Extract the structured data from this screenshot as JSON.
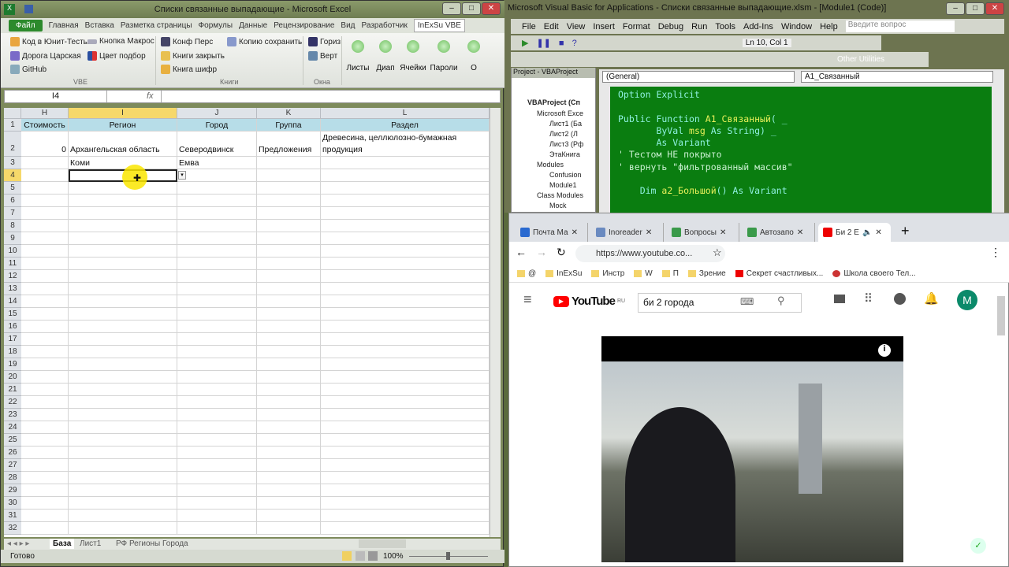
{
  "excel": {
    "title": "Списки связанные выпадающие - Microsoft Excel",
    "tabs": [
      "Файл",
      "Главная",
      "Вставка",
      "Разметка страницы",
      "Формулы",
      "Данные",
      "Рецензирование",
      "Вид",
      "Разработчик",
      "InExSu VBE"
    ],
    "ribbon": {
      "vbe": [
        "Код в Юнит-Тесты",
        "Кнопка Макрос",
        "Дорога Царская",
        "Цвет подбор",
        "GitHub"
      ],
      "vbe_group": "VBE",
      "books": [
        "Конф Перс",
        "Копию сохранить",
        "Книги закрыть",
        "Книга шифр"
      ],
      "books_group": "Книги",
      "windows": [
        "Гориз",
        "Верт"
      ],
      "windows_group": "Окна",
      "big": [
        "Листы",
        "Диап",
        "Ячейки",
        "Пароли",
        "О"
      ]
    },
    "name_box": "I4",
    "fx": "fx",
    "columns": [
      "H",
      "I",
      "J",
      "K",
      "L"
    ],
    "rows": [
      "1",
      "2",
      "3",
      "4",
      "5",
      "6",
      "7",
      "8",
      "9",
      "10",
      "11",
      "12",
      "13",
      "14",
      "15",
      "16",
      "17",
      "18",
      "19",
      "20",
      "21",
      "22",
      "23",
      "24",
      "25",
      "26",
      "27",
      "28",
      "29",
      "30",
      "31",
      "32"
    ],
    "cells": {
      "r1": [
        "Стоимость",
        "Регион",
        "Город",
        "Группа",
        "Раздел"
      ],
      "r2": [
        "0",
        "Архангельская область",
        "Северодвинск",
        "Предложения",
        "Древесина, целлюлозно-бумажная",
        "продукция"
      ],
      "r3": [
        "",
        "Коми",
        "Емва",
        "",
        ""
      ]
    },
    "sheets": [
      "База",
      "Лист1",
      "РФ Регионы Города"
    ],
    "status": "Готово",
    "zoom": "100%"
  },
  "vba": {
    "title": "Microsoft Visual Basic for Applications - Списки связанные выпадающие.xlsm - [Module1 (Code)]",
    "menu": [
      "File",
      "Edit",
      "View",
      "Insert",
      "Format",
      "Debug",
      "Run",
      "Tools",
      "Add-Ins",
      "Window",
      "Help"
    ],
    "help_placeholder": "Введите вопрос",
    "position": "Ln 10, Col 1",
    "other_utilities": "Other Utilities",
    "project_title": "Project - VBAProject",
    "tree": [
      "VBAProject (Сп",
      "Microsoft Exce",
      "Лист1 (Ба",
      "Лист2 (Л",
      "Лист3 (Рф",
      "ЭтаКнига",
      "Modules",
      "Confusion",
      "Module1",
      "Class Modules",
      "Mock"
    ],
    "general": "(General)",
    "proc": "A1_Связанный",
    "code": {
      "l1": "Option Explicit",
      "l2a": "Public Function ",
      "l2b": "A1_Связанный",
      "l2c": "( _",
      "l3a": "       ByVal ",
      "l3b": "msg",
      "l3c": " As String) _",
      "l4": "       As Variant",
      "l5": "' Тестом НЕ покрыто",
      "l6": "' вернуть \"фильтрованный массив\"",
      "l7a": "    Dim ",
      "l7b": "a2_Большой",
      "l7c": "() As Variant"
    }
  },
  "chrome": {
    "tabs": [
      "Почта Ма",
      "Inoreader",
      "Вопросы",
      "Автозапо",
      "Би 2 Е"
    ],
    "url": "https://www.youtube.co...",
    "bookmarks": [
      "@",
      "InExSu",
      "Инстр",
      "W",
      "П",
      "Зрение",
      "Секрет счастливых...",
      "Школа своего Тел..."
    ],
    "yt_logo": "YouTube",
    "yt_region": "RU",
    "search": "би 2 города",
    "avatar": "M",
    "info": "i"
  }
}
